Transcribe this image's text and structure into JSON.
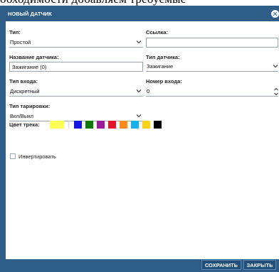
{
  "caption_above": "обходимости добавляем требуемые",
  "dialog": {
    "title": "НОВЫЙ ДАТЧИК",
    "close_icon": "close-circle-icon"
  },
  "form": {
    "type": {
      "label": "Тип:",
      "value": "Простой"
    },
    "link": {
      "label": "Ссылка:",
      "value": ""
    },
    "sensor_name": {
      "label": "Название датчика:",
      "value": "Зажигание (0)"
    },
    "sensor_type": {
      "label": "Тип датчика:",
      "value": "Зажигание"
    },
    "input_type": {
      "label": "Тип входа:",
      "value": "Дискретный"
    },
    "input_number": {
      "label": "Номер входа:",
      "value": "0"
    },
    "calibration_type": {
      "label": "Тип тарировки:",
      "value": "Вкл/Выкл"
    },
    "track_color": {
      "label": "Цвет трека:",
      "selected": "#ffff55",
      "palette": [
        "#1515e6",
        "#0b7a0b",
        "#9b1a9b",
        "#e0162e",
        "#ff8c1a",
        "#1ab0ea",
        "#ffd21a",
        "#000000"
      ]
    },
    "invert": {
      "label": "Инвертировать",
      "checked": false
    }
  },
  "buttons": {
    "save": "СОХРАНИТЬ",
    "close": "ЗАКРЫТЬ"
  }
}
